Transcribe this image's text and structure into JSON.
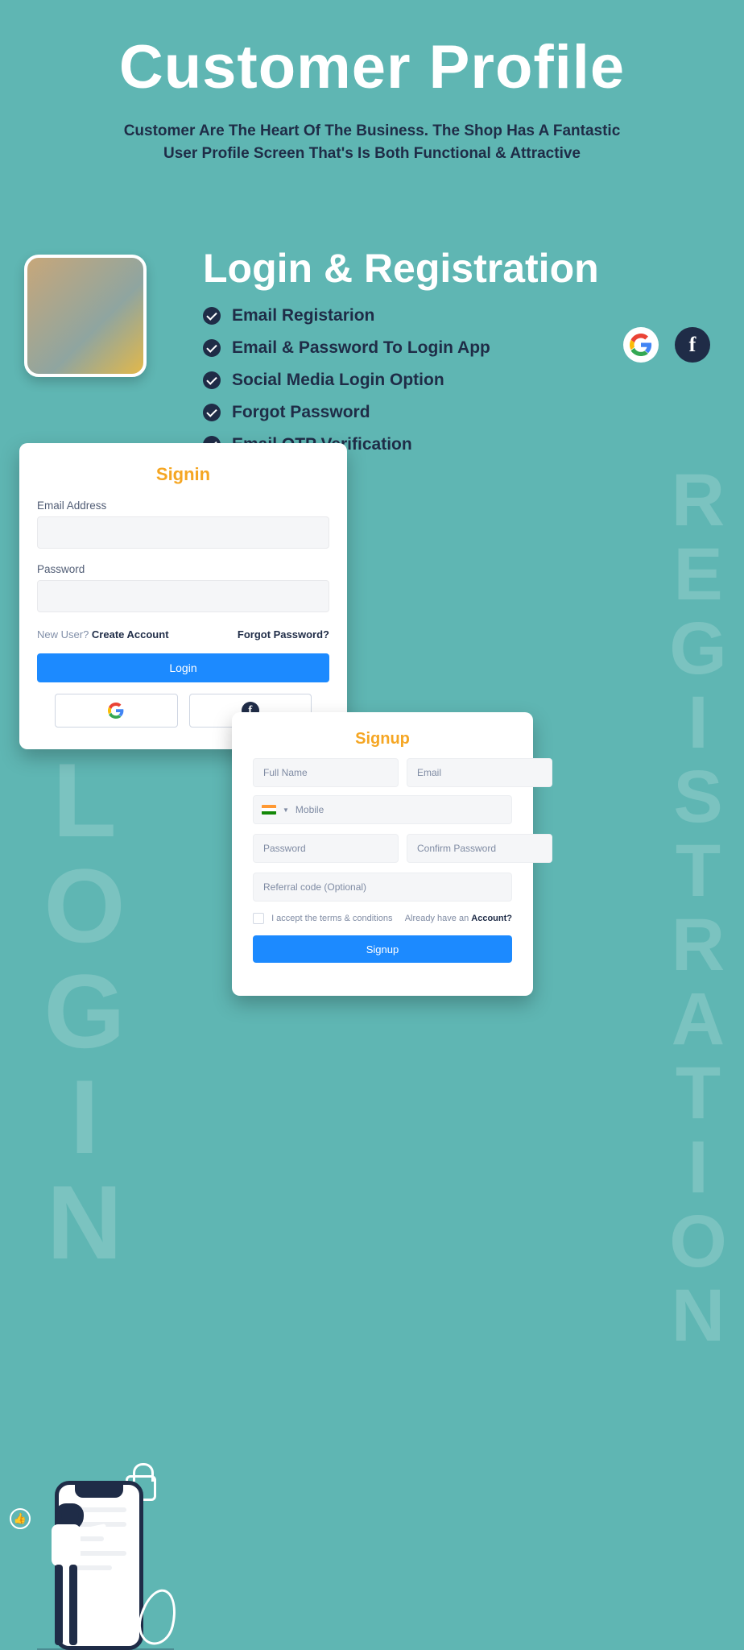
{
  "title": "Customer Profile",
  "subtitle_line1": "Customer Are The Heart Of The Business. The Shop Has A Fantastic",
  "subtitle_line2": "User Profile Screen That's Is Both Functional & Attractive",
  "section_heading": "Login & Registration",
  "features": [
    "Email Registarion",
    "Email & Password To Login App",
    "Social Media Login Option",
    "Forgot Password",
    "Email OTP Verification"
  ],
  "bg_text_login": "LOGIN",
  "bg_text_registration": "REGISTRATION",
  "signin": {
    "title": "Signin",
    "email_label": "Email Address",
    "password_label": "Password",
    "new_user_prefix": "New User? ",
    "create_account": "Create Account",
    "forgot_password": "Forgot Password?",
    "login_btn": "Login"
  },
  "signup": {
    "title": "Signup",
    "full_name_ph": "Full Name",
    "email_ph": "Email",
    "mobile_ph": "Mobile",
    "password_ph": "Password",
    "confirm_password_ph": "Confirm Password",
    "referral_ph": "Referral code (Optional)",
    "terms_text": "I accept the terms & conditions",
    "already_have_prefix": "Already have an ",
    "account_word": "Account?",
    "signup_btn": "Signup"
  }
}
